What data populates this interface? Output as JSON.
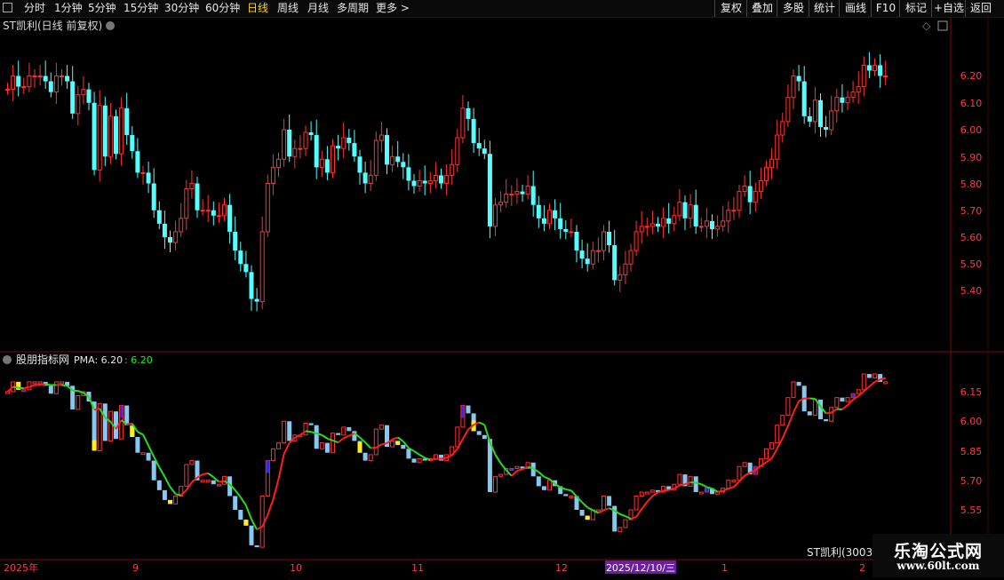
{
  "toolbar": {
    "periods": [
      "分时",
      "1分钟",
      "5分钟",
      "15分钟",
      "30分钟",
      "60分钟",
      "日线",
      "周线",
      "月线",
      "多周期",
      "更多"
    ],
    "active_period": "日线",
    "right_buttons": [
      "复权",
      "叠加",
      "多股",
      "统计",
      "画线",
      "F10",
      "标记",
      "+自选",
      "返回"
    ]
  },
  "price_panel": {
    "title": "ST凯利(日线 前复权)",
    "y_ticks": [
      "6.20",
      "6.10",
      "6.00",
      "5.90",
      "5.80",
      "5.70",
      "5.60",
      "5.50",
      "5.40"
    ]
  },
  "indicator_panel": {
    "name": "股朋指标网",
    "pma_label": "PMA: 6.20",
    "pma_value": ": 6.20",
    "y_ticks": [
      "6.15",
      "6.00",
      "5.85",
      "5.70",
      "5.55"
    ],
    "stock_label": "ST凯利(3003"
  },
  "date_axis": {
    "labels": [
      "2025年",
      "9",
      "10",
      "11",
      "12",
      "1",
      "2"
    ],
    "cursor_date": "2025/12/10/三"
  },
  "watermark": {
    "title": "乐淘公式网",
    "url": "www.60lt.com"
  },
  "colors": {
    "up": "#ff3232",
    "down": "#54ffff",
    "ma_rising": "#ff1e1e",
    "ma_falling": "#22dd22",
    "active_tab": "#ffd400"
  },
  "chart_data": {
    "type": "candlestick",
    "y_range": [
      5.3,
      6.3
    ],
    "close": [
      6.15,
      6.2,
      6.16,
      6.16,
      6.2,
      6.2,
      6.2,
      6.18,
      6.14,
      6.2,
      6.2,
      6.18,
      6.06,
      6.13,
      6.15,
      6.1,
      5.85,
      6.09,
      5.9,
      6.05,
      5.91,
      6.08,
      5.98,
      5.92,
      5.84,
      5.84,
      5.8,
      5.7,
      5.65,
      5.6,
      5.58,
      5.62,
      5.67,
      5.78,
      5.8,
      5.7,
      5.7,
      5.7,
      5.68,
      5.68,
      5.72,
      5.62,
      5.55,
      5.5,
      5.47,
      5.37,
      5.36,
      5.62,
      5.8,
      5.86,
      5.89,
      6.0,
      5.9,
      5.93,
      5.93,
      5.99,
      5.98,
      5.86,
      5.89,
      5.84,
      5.94,
      5.93,
      5.97,
      5.95,
      5.9,
      5.84,
      5.8,
      5.83,
      5.96,
      5.98,
      5.87,
      5.9,
      5.88,
      5.86,
      5.81,
      5.79,
      5.81,
      5.8,
      5.81,
      5.83,
      5.8,
      5.83,
      5.87,
      5.97,
      6.08,
      6.04,
      5.95,
      5.93,
      5.91,
      5.64,
      5.72,
      5.73,
      5.76,
      5.76,
      5.77,
      5.76,
      5.79,
      5.72,
      5.67,
      5.65,
      5.7,
      5.67,
      5.63,
      5.62,
      5.62,
      5.55,
      5.52,
      5.5,
      5.55,
      5.55,
      5.62,
      5.57,
      5.44,
      5.46,
      5.5,
      5.55,
      5.62,
      5.64,
      5.64,
      5.65,
      5.64,
      5.67,
      5.65,
      5.68,
      5.73,
      5.67,
      5.72,
      5.64,
      5.64,
      5.66,
      5.63,
      5.64,
      5.66,
      5.7,
      5.7,
      5.77,
      5.79,
      5.73,
      5.77,
      5.81,
      5.86,
      5.89,
      5.98,
      6.03,
      6.12,
      6.2,
      6.18,
      6.05,
      6.03,
      6.11,
      6.01,
      6.0,
      6.07,
      6.12,
      6.1,
      6.12,
      6.14,
      6.16,
      6.24,
      6.22,
      6.24,
      6.2,
      6.2
    ]
  }
}
